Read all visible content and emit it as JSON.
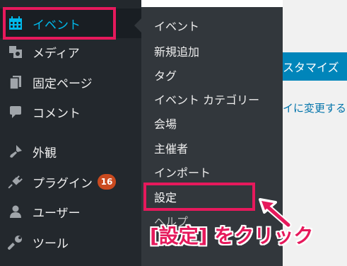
{
  "sidebar": {
    "items": [
      {
        "label": "イベント",
        "icon": "calendar-icon"
      },
      {
        "label": "メディア",
        "icon": "media-icon"
      },
      {
        "label": "固定ページ",
        "icon": "pages-icon"
      },
      {
        "label": "コメント",
        "icon": "comment-icon"
      },
      {
        "label": "外観",
        "icon": "appearance-icon"
      },
      {
        "label": "プラグイン",
        "icon": "plugin-icon",
        "badge": "16"
      },
      {
        "label": "ユーザー",
        "icon": "user-icon"
      },
      {
        "label": "ツール",
        "icon": "tools-icon"
      }
    ]
  },
  "flyout": {
    "items": [
      "イベント",
      "新規追加",
      "タグ",
      "イベント カテゴリー",
      "会場",
      "主催者",
      "インポート",
      "設定",
      "ヘルプ"
    ]
  },
  "content": {
    "button_label": "スタマイズ",
    "link_text": "イに変更する"
  },
  "annotation": {
    "text": "[設定] をクリック"
  },
  "colors": {
    "highlight": "#e6195c",
    "sidebar_bg": "#23282d",
    "flyout_bg": "#32373c",
    "active_text": "#00b9eb",
    "badge": "#ca4a1f",
    "primary_button": "#0085ba"
  }
}
